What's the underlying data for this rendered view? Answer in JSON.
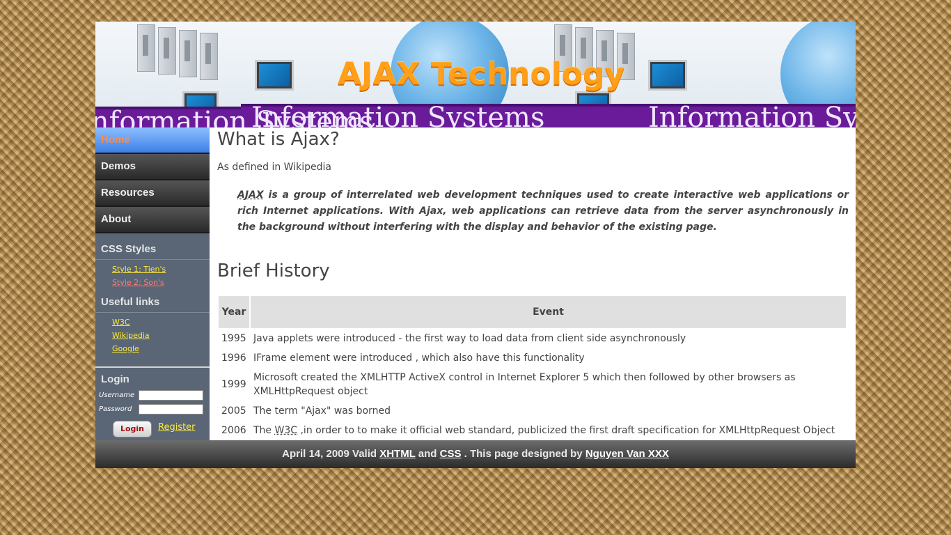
{
  "banner": {
    "title": "AJAX Technology",
    "band_text": "Information Systems"
  },
  "nav": {
    "items": [
      {
        "label": "Home",
        "active": true
      },
      {
        "label": "Demos",
        "active": false
      },
      {
        "label": "Resources",
        "active": false
      },
      {
        "label": "About",
        "active": false
      }
    ]
  },
  "sidebar": {
    "css_styles_heading": "CSS Styles",
    "css_styles": [
      "Style 1: Tien's",
      "Style 2: Son's"
    ],
    "useful_links_heading": "Useful links",
    "useful_links": [
      "W3C",
      "Wikipedia",
      "Google"
    ],
    "login": {
      "heading": "Login",
      "username_label": "Username",
      "password_label": "Password",
      "username_value": "",
      "password_value": "",
      "login_button": "Login",
      "register_link": "Register"
    }
  },
  "main": {
    "title": "What is Ajax?",
    "defined": "As defined in Wikipedia",
    "quote_abbr": "AJAX",
    "quote_rest": " is a group of interrelated web development techniques used to create interactive web applications or rich Internet applications. With Ajax, web applications can retrieve data from the server asynchronously in the background without interfering with the display and behavior of the existing page.",
    "history_title": "Brief History",
    "table": {
      "headers": [
        "Year",
        "Event"
      ],
      "rows": [
        {
          "year": "1995",
          "event": "Java applets were introduced - the first way to load data from client side asynchronously"
        },
        {
          "year": "1996",
          "event": "IFrame element were introduced , which also have this functionality"
        },
        {
          "year": "1999",
          "event": "Microsoft created the XMLHTTP ActiveX control in Internet Explorer 5 which then followed by other browsers as XMLHttpRequest object"
        },
        {
          "year": "2005",
          "event": "The term \"Ajax\" was borned"
        },
        {
          "year": "2006",
          "event_pre": "The ",
          "event_abbr": "W3C",
          "event_post": " ,in order to to make it official web standard, publicized the first draft specification for XMLHttpRequest Object"
        }
      ]
    }
  },
  "footer": {
    "date_text": "April 14, 2009 Valid ",
    "xhtml": "XHTML",
    "and": " and ",
    "css": "CSS",
    "designed": " . This page designed by ",
    "author": "Nguyen Van XXX"
  },
  "colors": {
    "accent_link": "#ffeb3b",
    "active_nav": "#3d7ee6",
    "sidebar_bg": "#5a6675"
  }
}
